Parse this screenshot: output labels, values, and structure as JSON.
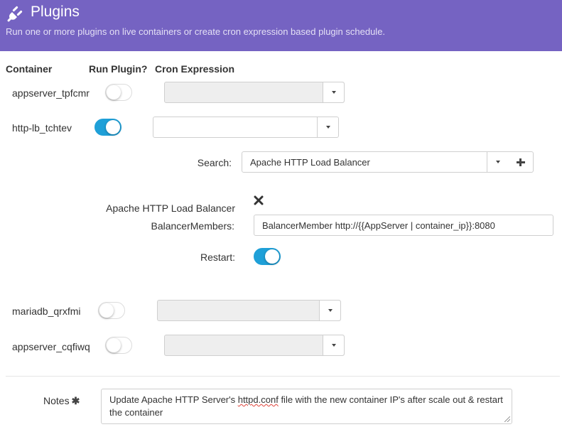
{
  "header": {
    "title": "Plugins",
    "subtitle": "Run one or more plugins on live containers or create cron expression based plugin schedule."
  },
  "columns": {
    "container": "Container",
    "run_plugin": "Run Plugin?",
    "cron": "Cron Expression"
  },
  "containers": [
    {
      "name": "appserver_tpfcmr",
      "run_plugin": false,
      "cron_disabled": true
    },
    {
      "name": "http-lb_tchtev",
      "run_plugin": true,
      "cron_disabled": false
    },
    {
      "name": "mariadb_qrxfmi",
      "run_plugin": false,
      "cron_disabled": true
    },
    {
      "name": "appserver_cqfiwq",
      "run_plugin": false,
      "cron_disabled": true
    }
  ],
  "plugin_config": {
    "search_label": "Search:",
    "search_value": "Apache HTTP Load Balancer",
    "plugin_name": "Apache HTTP Load Balancer",
    "balancer_label": "BalancerMembers:",
    "balancer_value": "BalancerMember http://{{AppServer | container_ip}}:8080",
    "restart_label": "Restart:",
    "restart": true
  },
  "notes": {
    "label": "Notes",
    "text_before": "Update Apache HTTP Server's ",
    "text_misspelled": "httpd.conf",
    "text_after": " file with the new container IP's after scale out & restart the container"
  },
  "colors": {
    "header_bg": "#7563c2",
    "toggle_on": "#1fa0d8"
  },
  "icons": [
    "plug-icon",
    "chevron-down-icon",
    "plus-icon",
    "close-icon",
    "asterisk-icon"
  ]
}
